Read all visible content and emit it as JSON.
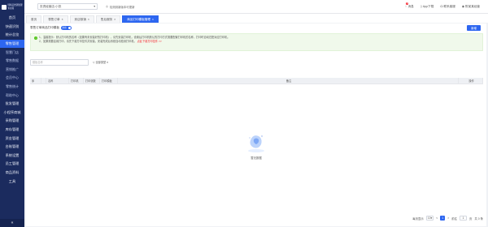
{
  "sidebar": {
    "logo_lines": [
      "饲料店经销管理",
      "专业版"
    ],
    "items": [
      {
        "label": "首页"
      },
      {
        "label": "快速识别"
      },
      {
        "label": "统计总览"
      },
      {
        "label": "零售管理"
      },
      {
        "label": "智慧门店"
      },
      {
        "label": "零售数据"
      },
      {
        "label": "营销推广"
      },
      {
        "label": "会员中心"
      },
      {
        "label": "零售统计"
      },
      {
        "label": "帮助中心"
      },
      {
        "label": "批发管理"
      },
      {
        "label": "小程序商城"
      },
      {
        "label": "采购管理"
      },
      {
        "label": "库存管理"
      },
      {
        "label": "资金管理"
      },
      {
        "label": "台账管理"
      },
      {
        "label": "系统设置"
      },
      {
        "label": "员工管理"
      },
      {
        "label": "商品资料"
      },
      {
        "label": "工具"
      }
    ],
    "collapse_icon": "double-chevron-left"
  },
  "topbar": {
    "store": "农资经营店-小张",
    "notice": "检测到新版本可更新",
    "right_items": [
      {
        "label": "消息",
        "icon": "bell-icon",
        "badge": "9"
      },
      {
        "label": "App下载",
        "icon": "phone-icon"
      },
      {
        "label": "联系客服",
        "icon": "headset-icon"
      },
      {
        "label": "陈某某经营",
        "icon": "user-icon"
      }
    ]
  },
  "tabs": [
    {
      "label": "首页"
    },
    {
      "label": "零售订单"
    },
    {
      "label": "到店核销"
    },
    {
      "label": "售后服务"
    },
    {
      "label": "商品打印模板管理"
    }
  ],
  "toolbar": {
    "toggle_label": "零售订单商品打印模板",
    "toggle_value": "启用",
    "add_button": "新增"
  },
  "alert": {
    "line1": "1、温馨提示：默认打印机的名称（如果有未安装好的打印机），请先安装打印机，设置后打印机默认的打印方式需要配置打印机的名称，打印时自动匹配对应打印机。",
    "line2_prefix": "2、如果需要启用打印，请先下载打印控件并安装，安装完成后系统自动检测打印机。",
    "line2_link": "点此下载打印控件 >>"
  },
  "filters": {
    "search_placeholder": "模板名称",
    "select_label": "全部类型"
  },
  "table": {
    "columns": [
      "序",
      "名称",
      "打印机",
      "打印张数",
      "打印模板",
      "备注",
      "操作"
    ]
  },
  "empty": {
    "text": "暂无数据"
  },
  "pager": {
    "page_size": "每页显示",
    "page_size_value": "10",
    "prev": "<",
    "current": "1",
    "next": ">",
    "goto_label": "前往",
    "goto_value": "1",
    "total": "共 0 条",
    "page_unit": "页"
  },
  "colors": {
    "sidebar": "#1b2b5e",
    "accent": "#2d66f0",
    "alert_bg": "#f0f9eb"
  }
}
